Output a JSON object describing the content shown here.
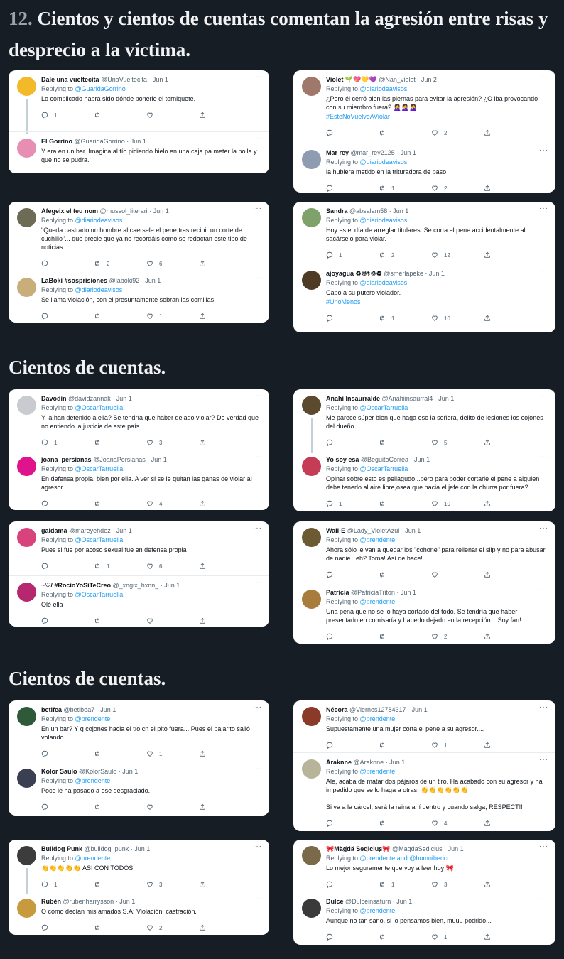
{
  "heading": {
    "number": "12.",
    "text": "Cientos y cientos de cuentas comentan la agresión entre risas y desprecio a la víctima."
  },
  "subheadings": [
    "Cientos de cuentas.",
    "Cientos de cuentas."
  ],
  "common": {
    "replying": "Replying to",
    "more": "···"
  },
  "cards": [
    {
      "tweets": [
        {
          "name": "Dale una vueltecita",
          "handle": "@UnaVueltecita",
          "date": "· Jun 1",
          "reply_to": "@GuaridaGorrino",
          "text": "Lo complicado habrá sido dónde ponerle el torniquete.",
          "tag": "",
          "replies": "1",
          "retweets": "",
          "likes": "",
          "avatar": "#f2b928"
        },
        {
          "name": "El Gorrino",
          "handle": "@GuaridaGorrino",
          "date": "· Jun 1",
          "reply_to": "",
          "text": "Y era en un bar. Imagina al tío pidiendo hielo en una caja pa meter la polla y que no se pudra.",
          "tag": "",
          "replies": "",
          "retweets": "",
          "likes": "",
          "avatar": "#e78fb3"
        }
      ]
    },
    {
      "tweets": [
        {
          "name": "Violet 🌱💖💛💜",
          "handle": "@Nan_violet",
          "date": "· Jun 2",
          "reply_to": "@diariodeavisos",
          "text": "¿Pero él cerró bien las piernas para evitar la agresión? ¿O iba provocando con su miembro fuera? 🤦‍♀️🤦‍♀️🤦‍♀️",
          "tag": "#EsteNoVuelveAViolar",
          "replies": "",
          "retweets": "",
          "likes": "2",
          "avatar": "#a0786b"
        },
        {
          "name": "Mar rey",
          "handle": "@mar_rey2125",
          "date": "· Jun 1",
          "reply_to": "@diariodeavisos",
          "text": "la hubiera metido en la trituradora de paso",
          "tag": "",
          "replies": "",
          "retweets": "1",
          "likes": "2",
          "avatar": "#8e9bb0"
        }
      ]
    },
    {
      "tweets": [
        {
          "name": "Afegeix el teu nom",
          "handle": "@mussol_literari",
          "date": "· Jun 1",
          "reply_to": "@diariodeavisos",
          "text": "\"Queda castrado un hombre al caersele el pene tras recibir un corte de cuchillo\"... que precie que ya no recordáis como se redactan este tipo de noticias...",
          "tag": "",
          "replies": "",
          "retweets": "2",
          "likes": "6",
          "avatar": "#6d6a55"
        },
        {
          "name": "LaBoki #sosprisiones",
          "handle": "@laboki92",
          "date": "· Jun 1",
          "reply_to": "@diariodeavisos",
          "text": "Se llama violación, con el presuntamente sobran las comillas",
          "tag": "",
          "replies": "",
          "retweets": "",
          "likes": "1",
          "avatar": "#c9ad7a"
        }
      ]
    },
    {
      "tweets": [
        {
          "name": "Sandra",
          "handle": "@absalam58",
          "date": "· Jun 1",
          "reply_to": "@diariodeavisos",
          "text": "Hoy es el día de arreglar titulares: Se corta el pene accidentalmente al sacárselo para violar.",
          "tag": "",
          "replies": "1",
          "retweets": "2",
          "likes": "12",
          "avatar": "#7fa26b"
        },
        {
          "name": "ajoyagua ♻♲⚕♲♻",
          "handle": "@smerlapeke",
          "date": "· Jun 1",
          "reply_to": "@diariodeavisos",
          "text": "Capó a su putero violador.",
          "tag": "#UnoMenos",
          "replies": "",
          "retweets": "1",
          "likes": "10",
          "avatar": "#4f3b25"
        }
      ]
    },
    {
      "tweets": [
        {
          "name": "Davodin",
          "handle": "@davidzannak",
          "date": "· Jun 1",
          "reply_to": "@OscarTarruella",
          "text": "Y la han detenido a ella? Se tendría que haber dejado violar? De verdad que no entiendo la justicia de este país.",
          "tag": "",
          "replies": "1",
          "retweets": "",
          "likes": "3",
          "avatar": "#c8ccd0"
        },
        {
          "name": "joana_persianas",
          "handle": "@JoanaPersianas",
          "date": "· Jun 1",
          "reply_to": "@OscarTarruella",
          "text": "En defensa propia, bien por ella. A ver si se le quitan las ganas de violar al agresor.",
          "tag": "",
          "replies": "",
          "retweets": "",
          "likes": "4",
          "avatar": "#e0138c"
        }
      ]
    },
    {
      "tweets": [
        {
          "name": "Anahi Insaurralde",
          "handle": "@Anahiinsaurral4",
          "date": "· Jun 1",
          "reply_to": "@OscarTarruella",
          "text": "Me parece súper bien que haga eso la señora, delito de lesiones los cojones del dueño",
          "tag": "",
          "replies": "",
          "retweets": "",
          "likes": "5",
          "avatar": "#5b4a2e"
        },
        {
          "name": "Yo soy esa",
          "handle": "@BeguitoCorrea",
          "date": "· Jun 1",
          "reply_to": "@OscarTarruella",
          "text": "Opinar sobre esto es peliagudo...pero para poder cortarle el pene a alguien debe tenerlo al aire libre,osea que hacia el jefe con la churra por fuera?....",
          "tag": "",
          "replies": "1",
          "retweets": "",
          "likes": "10",
          "avatar": "#c43c56"
        }
      ]
    },
    {
      "tweets": [
        {
          "name": "gaidama",
          "handle": "@mareyehdez",
          "date": "· Jun 1",
          "reply_to": "@OscarTarruella",
          "text": "Pues si fue por acoso sexual fue en defensa propia",
          "tag": "",
          "replies": "",
          "retweets": "1",
          "likes": "6",
          "avatar": "#d8437d"
        },
        {
          "name": "~♡/ #RocioYoSiTeCreo",
          "handle": "@_xngix_hxnn_",
          "date": "· Jun 1",
          "reply_to": "@OscarTarruella",
          "text": "Olé ella",
          "tag": "",
          "replies": "",
          "retweets": "",
          "likes": "",
          "avatar": "#b5276f"
        }
      ]
    },
    {
      "tweets": [
        {
          "name": "Wall-E",
          "handle": "@Lady_VioletAzul",
          "date": "· Jun 1",
          "reply_to": "@prendente",
          "text": "Ahora sólo le van a quedar los \"cohone\" para rellenar el slip y no para abusar de nadie...eh? Toma! Así de hace!",
          "tag": "",
          "replies": "",
          "retweets": "",
          "likes": "",
          "avatar": "#6b5a32"
        },
        {
          "name": "Patricia",
          "handle": "@PatriciaTriton",
          "date": "· Jun 1",
          "reply_to": "@prendente",
          "text": "Una pena que no se lo haya cortado del todo. Se tendría que haber presentado en comisaría y haberlo dejado en la recepción... Soy fan!",
          "tag": "",
          "replies": "",
          "retweets": "",
          "likes": "2",
          "avatar": "#a87c3c"
        }
      ]
    },
    {
      "tweets": [
        {
          "name": "betifea",
          "handle": "@betibea7",
          "date": "· Jun 1",
          "reply_to": "@prendente",
          "text": "En un bar? Y q cojones hacia el tío cn el pito fuera... Pues el pajarito salió volando",
          "tag": "",
          "replies": "",
          "retweets": "",
          "likes": "1",
          "avatar": "#2f5a3a"
        },
        {
          "name": "Kolor Saulo",
          "handle": "@KolorSaulo",
          "date": "· Jun 1",
          "reply_to": "@prendente",
          "text": "Poco le ha pasado a ese desgraciado.",
          "tag": "",
          "replies": "",
          "retweets": "",
          "likes": "",
          "avatar": "#3a3f52"
        }
      ]
    },
    {
      "tweets": [
        {
          "name": "Nécora",
          "handle": "@Viernes12784317",
          "date": "· Jun 1",
          "reply_to": "@prendente",
          "text": "Supuestamente una mujer corta el pene a su agresor....",
          "tag": "",
          "replies": "",
          "retweets": "",
          "likes": "1",
          "avatar": "#8b3a2a"
        },
        {
          "name": "Araknne",
          "handle": "@Araknne",
          "date": "· Jun 1",
          "reply_to": "@prendente",
          "text": "Ale, acaba de matar dos pájaros de un tiro. Ha acabado con su agresor y ha impedido que se lo haga a otras. 👏👏👏👏👏👏\n\nSi va a la cárcel, será la reina ahí dentro y cuando salga, RESPECT!!",
          "tag": "",
          "replies": "",
          "retweets": "",
          "likes": "4",
          "avatar": "#b8b49a"
        }
      ]
    },
    {
      "tweets": [
        {
          "name": "Bulldog Punk",
          "handle": "@bulldog_punk",
          "date": "· Jun 1",
          "reply_to": "@prendente",
          "text": "👏👏👏👏👏 ASÍ CON TODOS",
          "tag": "",
          "replies": "1",
          "retweets": "",
          "likes": "3",
          "avatar": "#3c3c3c"
        },
        {
          "name": "Rubén",
          "handle": "@rubenharrysson",
          "date": "· Jun 1",
          "reply_to": "",
          "text": "O como decían mis amados S.A: Violación; castración.",
          "tag": "",
          "replies": "",
          "retweets": "",
          "likes": "2",
          "avatar": "#c89a3e"
        }
      ]
    },
    {
      "tweets": [
        {
          "name": "🎀Măɠdă Sɘɖiciuʂ🎀",
          "handle": "@MagdaSedicius",
          "date": "· Jun 1",
          "reply_to": "@prendente and @humoiberico",
          "text": "Lo mejor seguramente que voy a leer hoy 🎀",
          "tag": "",
          "replies": "",
          "retweets": "1",
          "likes": "3",
          "avatar": "#7a6a4a"
        },
        {
          "name": "Dulce",
          "handle": "@Dulceinsaturn",
          "date": "· Jun 1",
          "reply_to": "@prendente",
          "text": "Aunque no tan sano, si lo pensamos bien, muuu podrido...",
          "tag": "",
          "replies": "",
          "retweets": "",
          "likes": "1",
          "avatar": "#3a3a3a"
        }
      ]
    }
  ]
}
